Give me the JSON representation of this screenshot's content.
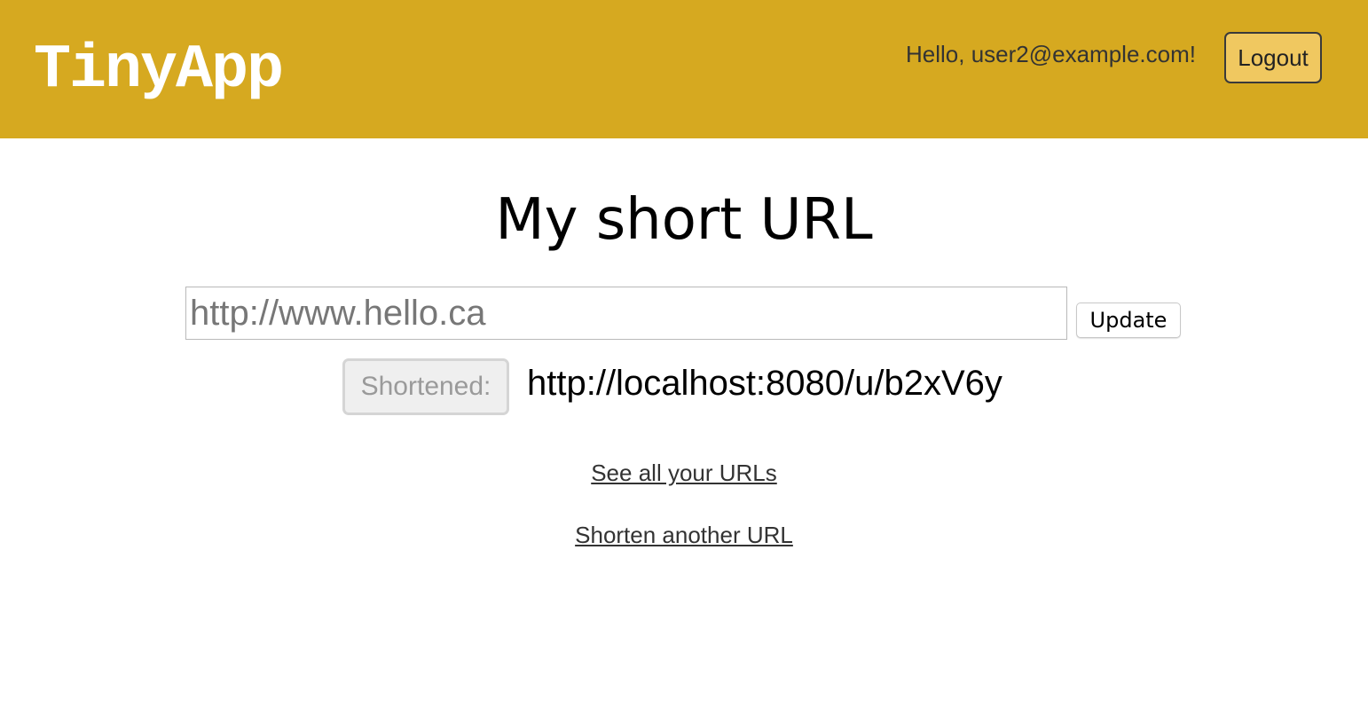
{
  "header": {
    "logo": "TinyApp",
    "greeting": "Hello, user2@example.com!",
    "logout_label": "Logout",
    "background_color": "#d6a920",
    "button_color": "#f0c860"
  },
  "main": {
    "title": "My short URL",
    "long_url_input": {
      "value": "http://www.hello.ca"
    },
    "update_label": "Update",
    "shortened_label": "Shortened:",
    "short_url": "http://localhost:8080/u/b2xV6y",
    "links": {
      "see_all": "See all your URLs",
      "shorten_another": "Shorten another URL"
    }
  }
}
